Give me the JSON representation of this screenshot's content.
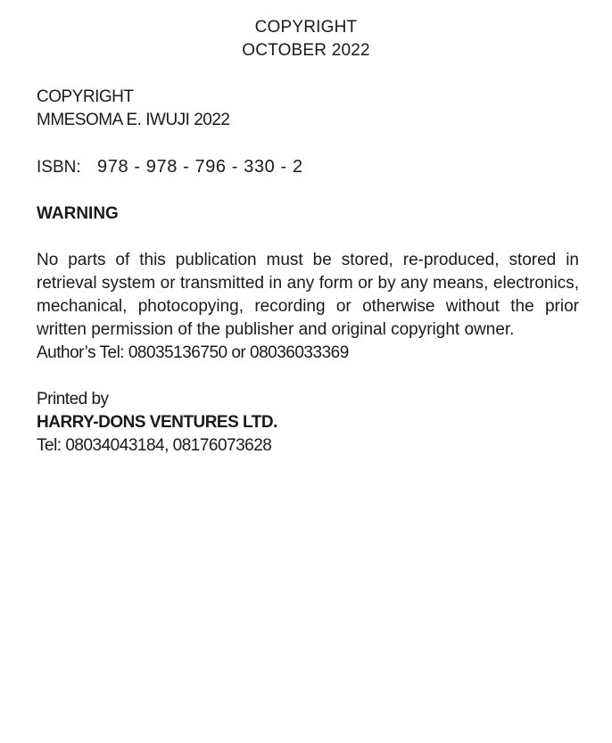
{
  "header": {
    "line1": "COPYRIGHT",
    "line2": "OCTOBER 2022"
  },
  "copyright": {
    "label": "COPYRIGHT",
    "holder": "MMESOMA E. IWUJI 2022"
  },
  "isbn": {
    "label": "ISBN:",
    "value": "978 - 978 - 796 - 330 - 2"
  },
  "warning": {
    "heading": "WARNING",
    "body": "No parts of this publication must be stored, re-produced, stored in retrieval system or transmitted in any form or by any means, electronics, mechanical, photocopying, recording or otherwise without the prior written permission of the publisher and original copyright owner.",
    "author_tel": "Author’s Tel: 08035136750 or 08036033369"
  },
  "printer": {
    "label": "Printed by",
    "name": "HARRY-DONS VENTURES LTD.",
    "tel": "Tel: 08034043184, 08176073628"
  }
}
